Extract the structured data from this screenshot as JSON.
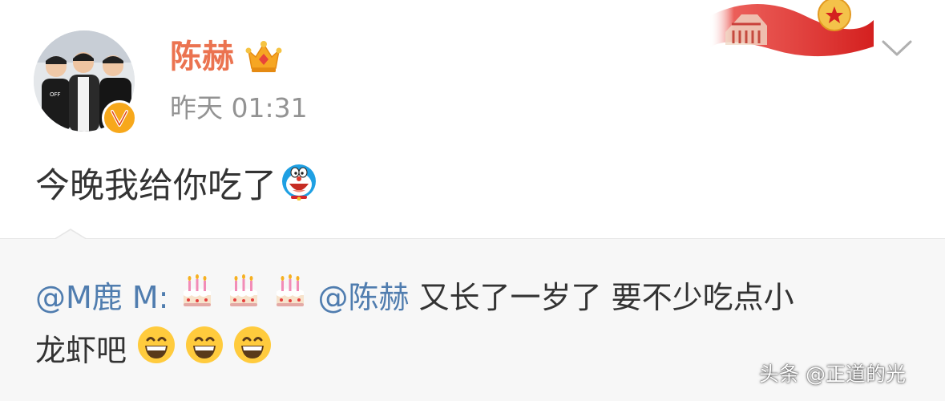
{
  "post": {
    "author": "陈赫",
    "time": "昨天 01:31",
    "text": "今晚我给你吃了",
    "icons": {
      "avatar": "group-photo-avatar",
      "verified": "verified-v-badge-icon",
      "crown": "vip-crown-icon",
      "banner": "red-flag-banner",
      "menu": "chevron-down-icon",
      "emoji": "doraemon-emoji"
    }
  },
  "repost": {
    "user_mention": "@M鹿 M:",
    "reply_mention": "@陈赫",
    "text_line1": "又长了一岁了 要不少吃点小",
    "text_line2": "龙虾吧",
    "emojis": [
      "birthday-cake-emoji",
      "grinning-face-emoji"
    ]
  },
  "watermark": "头条 @正道的光",
  "colors": {
    "author": "#eb7350",
    "mention": "#507daf",
    "time": "#939393",
    "repost_bg": "#f7f7f7",
    "verified_badge": "#f7a81b"
  }
}
